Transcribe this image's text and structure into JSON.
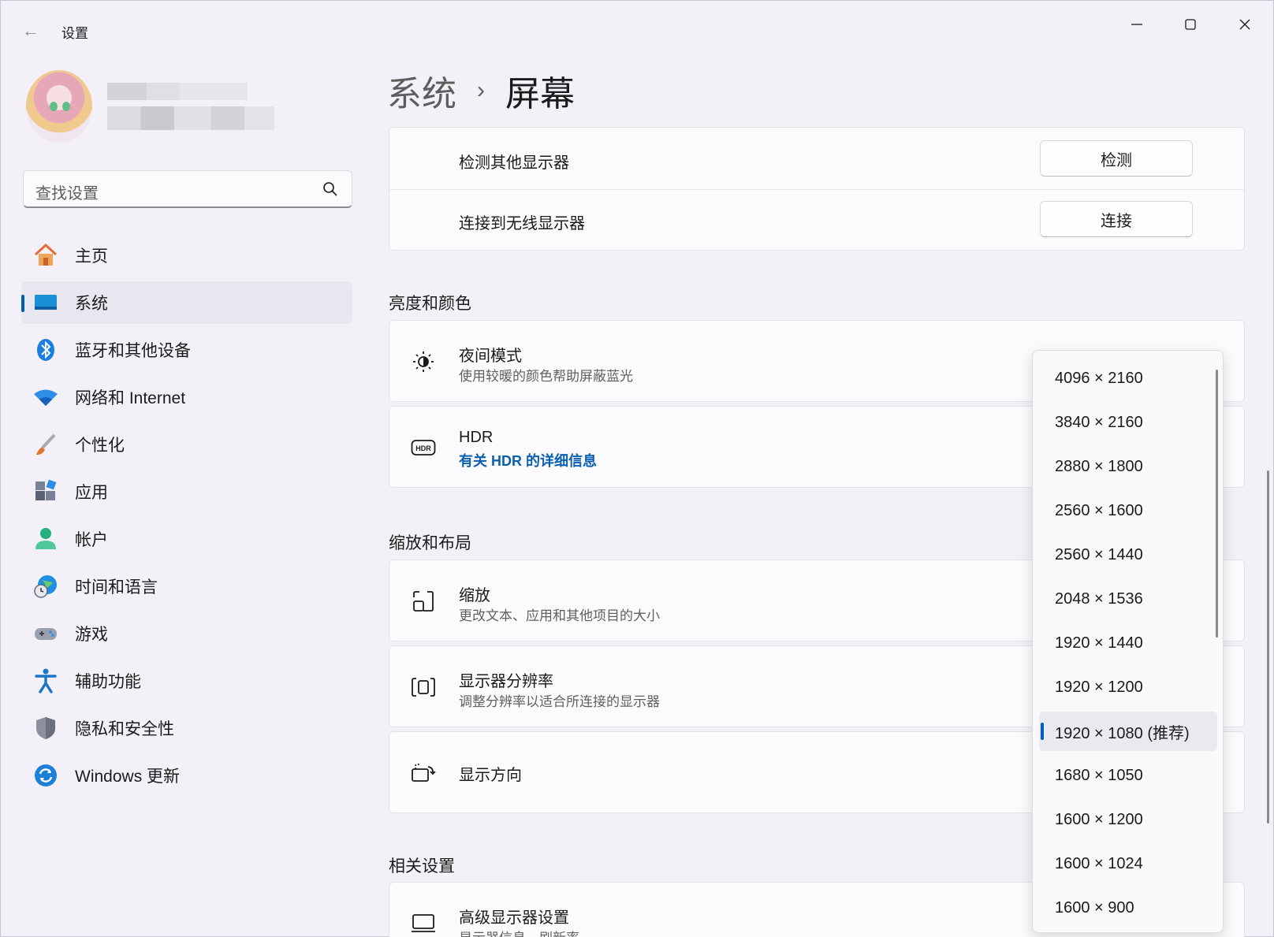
{
  "app": {
    "title": "设置"
  },
  "search": {
    "placeholder": "查找设置"
  },
  "sidebar": {
    "items": [
      {
        "label": "主页",
        "icon": "home-icon"
      },
      {
        "label": "系统",
        "icon": "system-display-icon"
      },
      {
        "label": "蓝牙和其他设备",
        "icon": "bluetooth-icon"
      },
      {
        "label": "网络和 Internet",
        "icon": "wifi-icon"
      },
      {
        "label": "个性化",
        "icon": "paintbrush-icon"
      },
      {
        "label": "应用",
        "icon": "apps-icon"
      },
      {
        "label": "帐户",
        "icon": "account-icon"
      },
      {
        "label": "时间和语言",
        "icon": "globe-clock-icon"
      },
      {
        "label": "游戏",
        "icon": "gamepad-icon"
      },
      {
        "label": "辅助功能",
        "icon": "accessibility-icon"
      },
      {
        "label": "隐私和安全性",
        "icon": "shield-icon"
      },
      {
        "label": "Windows 更新",
        "icon": "update-icon"
      }
    ],
    "active_index": 1
  },
  "breadcrumb": {
    "parent": "系统",
    "separator": "›",
    "current": "屏幕"
  },
  "display_actions": {
    "detect": {
      "title": "检测其他显示器",
      "button": "检测"
    },
    "wireless": {
      "title": "连接到无线显示器",
      "button": "连接"
    }
  },
  "brightness_section": {
    "title": "亮度和颜色",
    "night_mode": {
      "title": "夜间模式",
      "subtitle": "使用较暖的颜色帮助屏蔽蓝光"
    },
    "hdr": {
      "title": "HDR",
      "link": "有关 HDR 的详细信息"
    }
  },
  "scale_section": {
    "title": "缩放和布局",
    "scale": {
      "title": "缩放",
      "subtitle": "更改文本、应用和其他项目的大小"
    },
    "resolution": {
      "title": "显示器分辨率",
      "subtitle": "调整分辨率以适合所连接的显示器"
    },
    "orientation": {
      "title": "显示方向"
    }
  },
  "related_section": {
    "title": "相关设置",
    "advanced": {
      "title": "高级显示器设置",
      "subtitle": "显示器信息、刷新率"
    }
  },
  "resolution_dropdown": {
    "options": [
      "4096 × 2160",
      "3840 × 2160",
      "2880 × 1800",
      "2560 × 1600",
      "2560 × 1440",
      "2048 × 1536",
      "1920 × 1440",
      "1920 × 1200",
      "1920 × 1080 (推荐)",
      "1680 × 1050",
      "1600 × 1200",
      "1600 × 1024",
      "1600 × 900"
    ],
    "selected_index": 8
  },
  "colors": {
    "accent": "#005fb8",
    "link": "#0a5fb0"
  }
}
